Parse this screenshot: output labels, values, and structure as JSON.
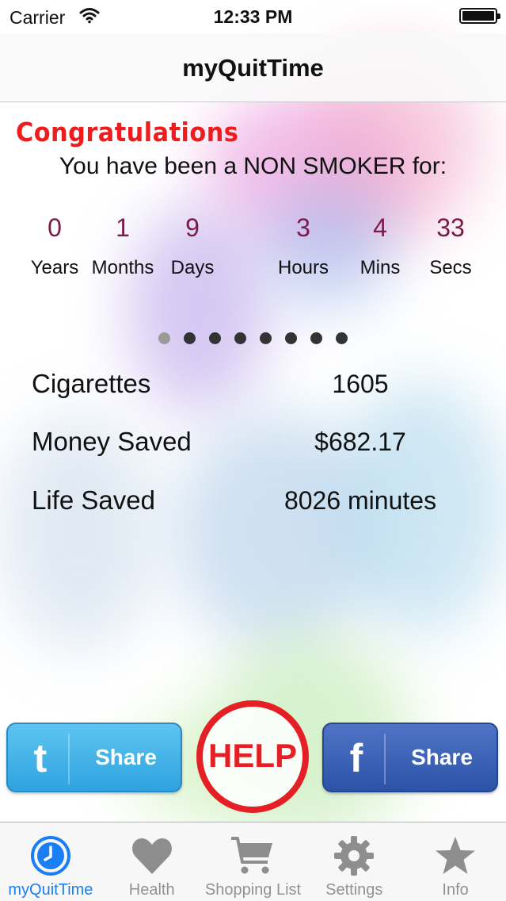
{
  "status_bar": {
    "carrier": "Carrier",
    "time": "12:33 PM"
  },
  "nav": {
    "title": "myQuitTime"
  },
  "main": {
    "congrats": "Congratulations",
    "headline": "You have been a NON SMOKER for:",
    "counters": [
      {
        "value": "0",
        "unit": "Years"
      },
      {
        "value": "1",
        "unit": "Months"
      },
      {
        "value": "9",
        "unit": "Days"
      },
      {
        "value": "3",
        "unit": "Hours"
      },
      {
        "value": "4",
        "unit": "Mins"
      },
      {
        "value": "33",
        "unit": "Secs"
      }
    ],
    "page_dots": {
      "count": 8,
      "active_index": 0
    },
    "stats": [
      {
        "label": "Cigarettes",
        "value": "1605"
      },
      {
        "label": "Money Saved",
        "value": "$682.17"
      },
      {
        "label": "Life Saved",
        "value": "8026 minutes"
      }
    ]
  },
  "actions": {
    "twitter_share": {
      "icon": "twitter-icon",
      "glyph": "t",
      "label": "Share"
    },
    "help": {
      "label": "HELP"
    },
    "facebook_share": {
      "icon": "facebook-icon",
      "glyph": "f",
      "label": "Share"
    }
  },
  "tab_bar": {
    "items": [
      {
        "label": "myQuitTime",
        "icon": "clock-icon",
        "active": true
      },
      {
        "label": "Health",
        "icon": "heart-icon",
        "active": false
      },
      {
        "label": "Shopping List",
        "icon": "cart-icon",
        "active": false
      },
      {
        "label": "Settings",
        "icon": "gear-icon",
        "active": false
      },
      {
        "label": "Info",
        "icon": "star-icon",
        "active": false
      }
    ]
  },
  "colors": {
    "accent": "#1a7ef4",
    "congrats": "#ee1c1c",
    "counter_number": "#7a1a4a",
    "help": "#e41f26",
    "twitter": "#2ea3e0",
    "facebook": "#2c53a8"
  }
}
